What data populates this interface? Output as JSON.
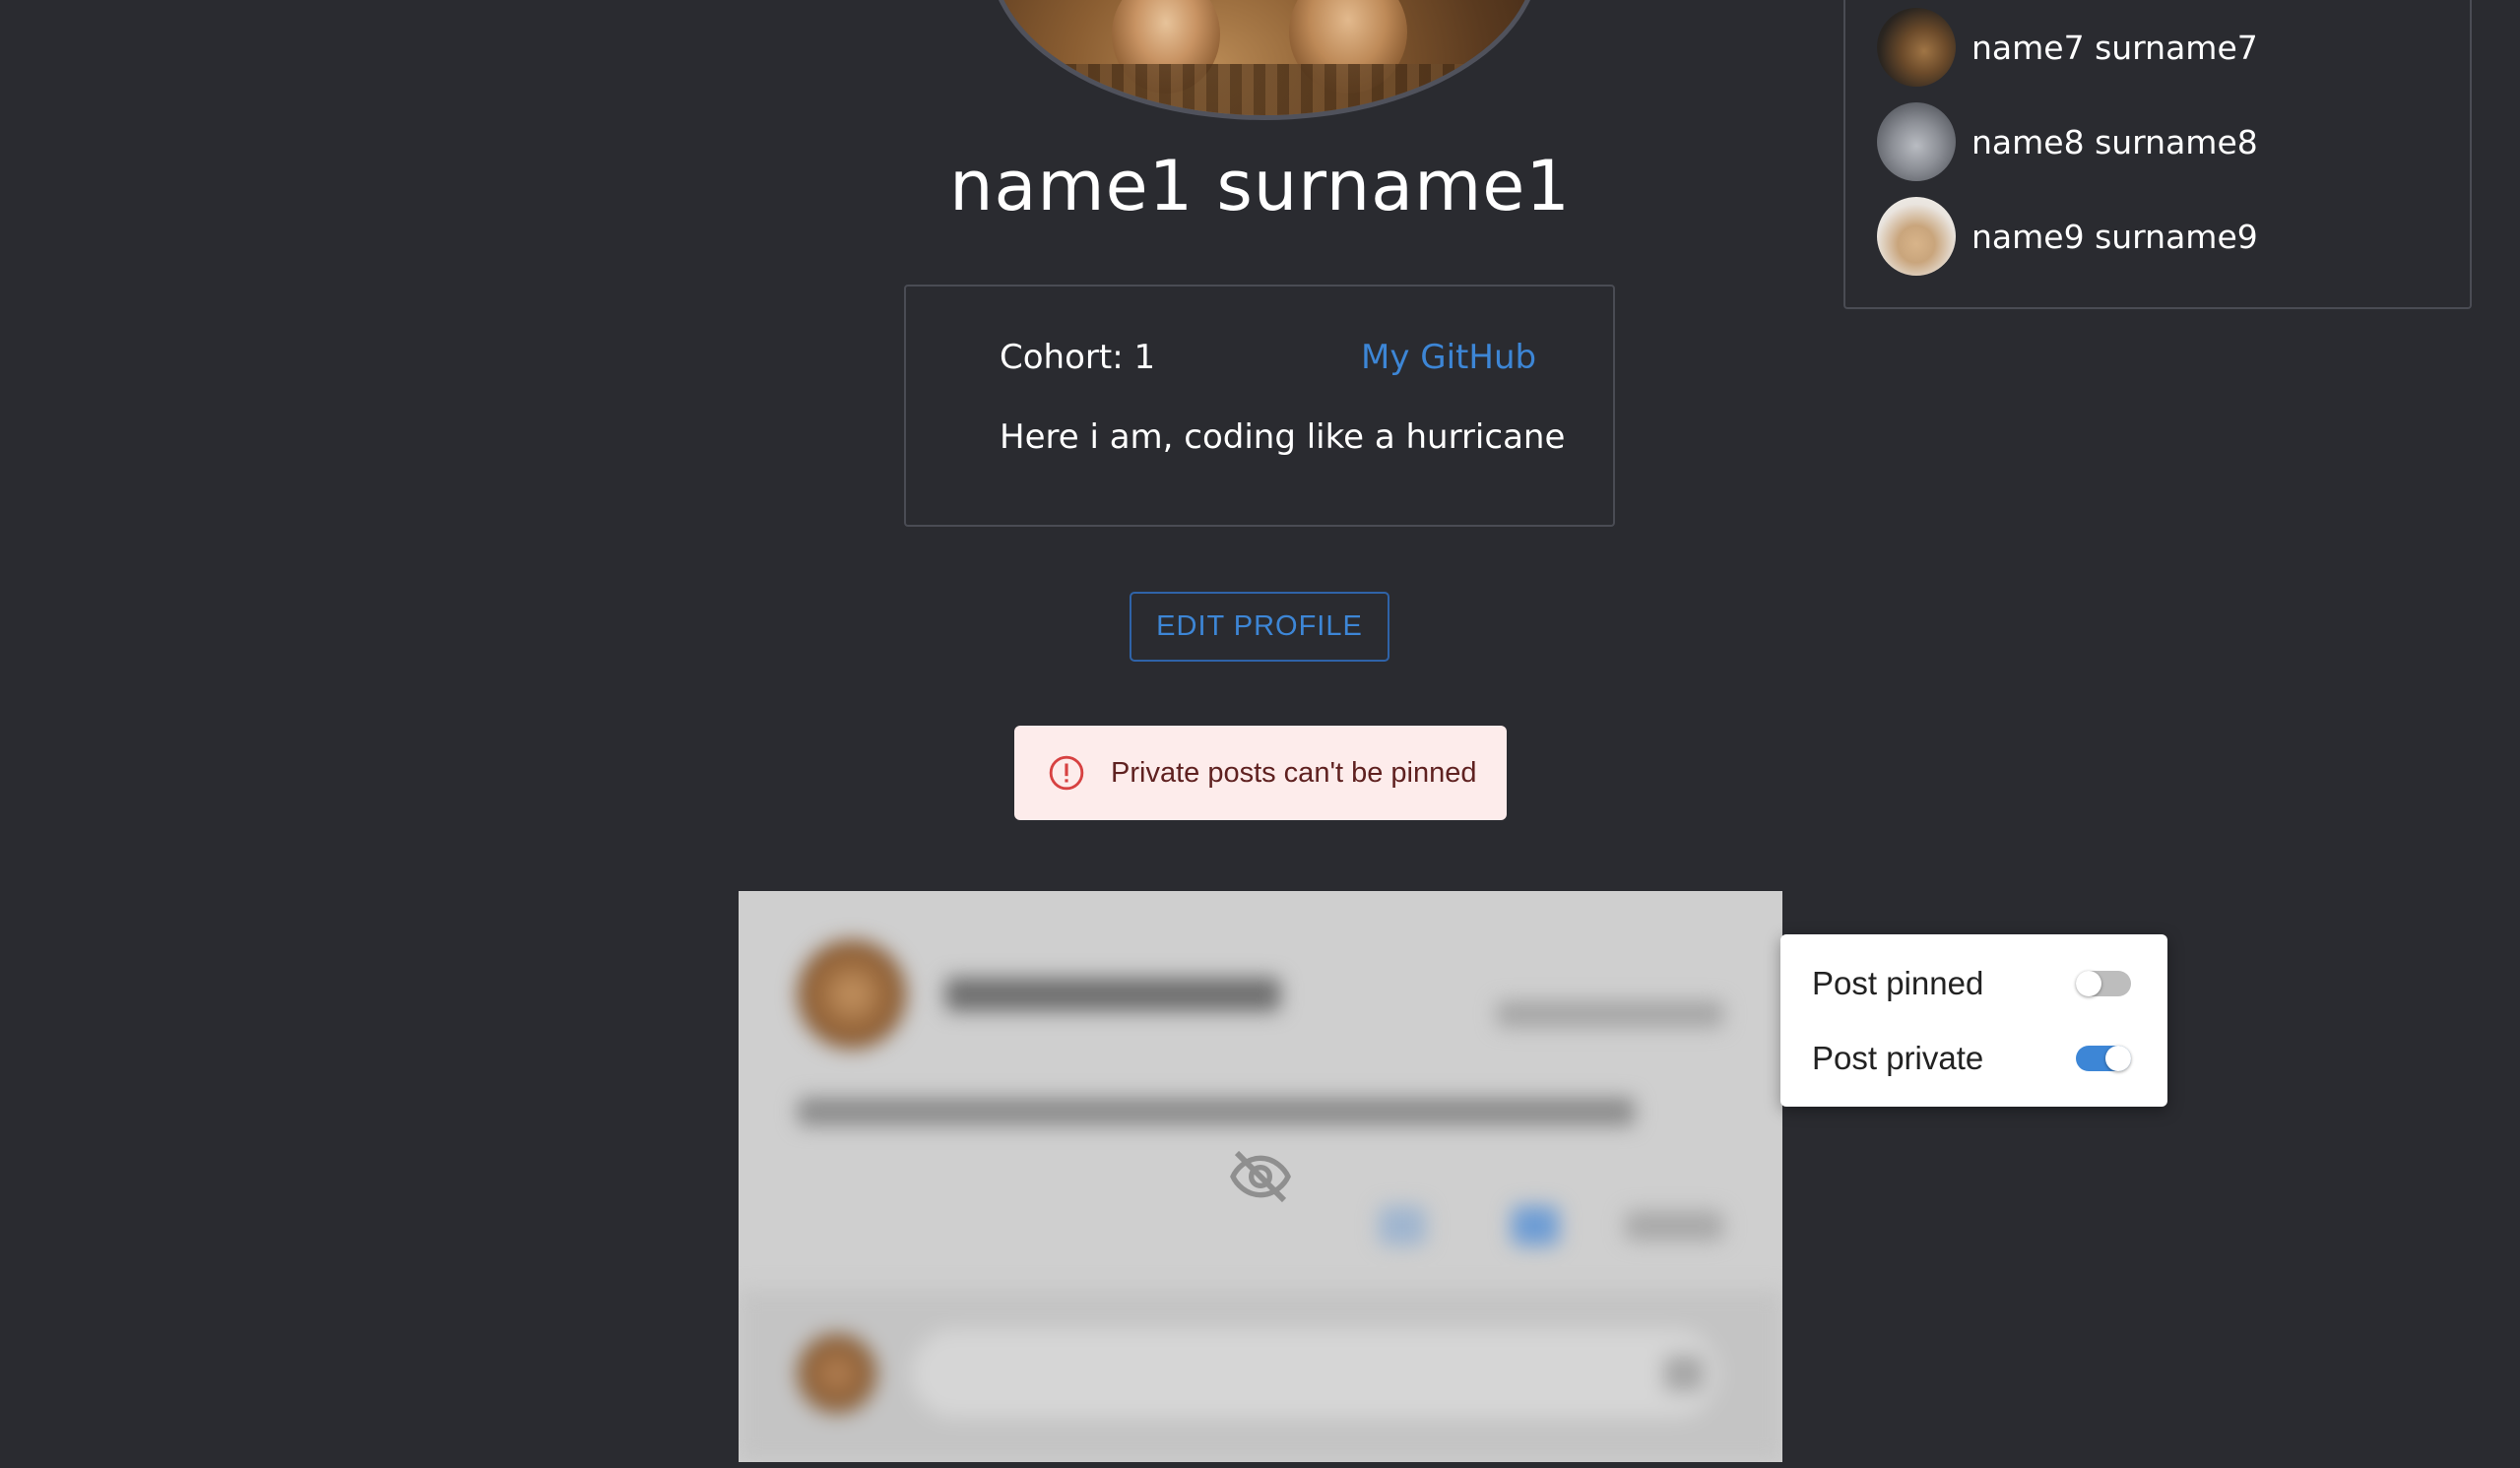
{
  "profile": {
    "name": "name1 surname1",
    "cohort": "Cohort: 1",
    "github_link": "My GitHub",
    "bio": "Here i am, coding like a hurricane",
    "edit_button": "EDIT PROFILE"
  },
  "alert": {
    "message": "Private posts can't be pinned",
    "icon": "error-outline-icon",
    "severity_color": "#d74141"
  },
  "followers": [
    {
      "name": "name7 surname7"
    },
    {
      "name": "name8 surname8"
    },
    {
      "name": "name9 surname9"
    }
  ],
  "post_menu": {
    "pinned_label": "Post pinned",
    "pinned_on": false,
    "private_label": "Post private",
    "private_on": true
  },
  "post": {
    "hidden_icon": "eye-off-icon"
  },
  "colors": {
    "background": "#2a2b30",
    "accent": "#3d86d6",
    "alert_bg": "#fdeceb"
  }
}
